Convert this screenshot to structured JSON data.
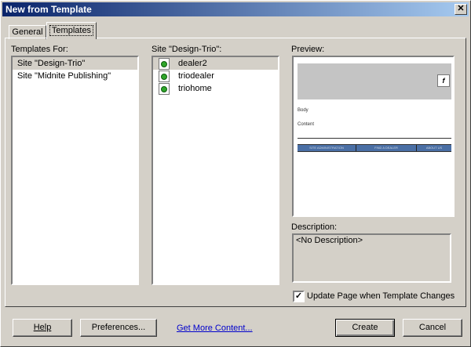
{
  "window": {
    "title": "New from Template",
    "close_glyph": "✕"
  },
  "tabs": [
    {
      "label": "General"
    },
    {
      "label": "Templates"
    }
  ],
  "templates_for": {
    "label": "Templates For:",
    "items": [
      {
        "label": "Site \"Design-Trio\"",
        "selected": true
      },
      {
        "label": "Site \"Midnite Publishing\"",
        "selected": false
      }
    ]
  },
  "site_templates": {
    "label": "Site \"Design-Trio\":",
    "items": [
      {
        "label": "dealer2",
        "icon": "template-file-icon",
        "selected": true
      },
      {
        "label": "triodealer",
        "icon": "template-file-icon",
        "selected": false
      },
      {
        "label": "triohome",
        "icon": "template-file-icon",
        "selected": false
      }
    ]
  },
  "preview": {
    "label": "Preview:",
    "thumb": {
      "flash_icon": "f",
      "text1": "Body",
      "text2": "Content",
      "nav": [
        "SITE ADMINISTRATION",
        "FIND A DEALER",
        "ABOUT US"
      ]
    }
  },
  "description": {
    "label": "Description:",
    "value": "<No Description>"
  },
  "update_checkbox": {
    "label": "Update Page when Template Changes",
    "checked": true,
    "check_glyph": "✓"
  },
  "buttons": {
    "help": "Help",
    "preferences": "Preferences...",
    "get_more": "Get More Content...",
    "create": "Create",
    "cancel": "Cancel"
  },
  "colors": {
    "titlebar_start": "#0a246a",
    "titlebar_end": "#a6caf0",
    "face": "#d4d0c8",
    "link": "#0000cc"
  }
}
